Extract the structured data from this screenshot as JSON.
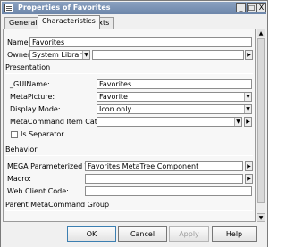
{
  "window": {
    "title": "Properties of Favorites",
    "minimize_glyph": "_",
    "maximize_glyph": "□",
    "close_glyph": "X"
  },
  "tabs": [
    {
      "label": "General",
      "active": false
    },
    {
      "label": "Characteristics",
      "active": true
    },
    {
      "label": "Texts",
      "active": false
    }
  ],
  "form": {
    "name_label": "Name:",
    "name_value": "Favorites",
    "owner_label": "Owner:",
    "owner_value": "System Library",
    "presentation_header": "Presentation",
    "guiname_label": "_GUIName:",
    "guiname_value": "Favorites",
    "metapicture_label": "MetaPicture:",
    "metapicture_value": "Favorite",
    "display_mode_label": "Display Mode:",
    "display_mode_value": "Icon only",
    "metacommand_category_label": "MetaCommand Item Category:",
    "metacommand_category_value": "",
    "is_separator_label": "Is Separator",
    "is_separator_checked": false,
    "behavior_header": "Behavior",
    "mega_tool_label": "MEGA Parameterized Tool:",
    "mega_tool_value": "Favorites MetaTree Component",
    "macro_label": "Macro:",
    "macro_value": "",
    "web_client_code_label": "Web Client Code:",
    "web_client_code_value": "",
    "parent_group_header": "Parent MetaCommand Group"
  },
  "glyphs": {
    "dropdown_arrow": "▼",
    "browse_arrow": "▶",
    "scroll_up": "▲",
    "scroll_down": "▼"
  },
  "buttons": {
    "ok": "OK",
    "cancel": "Cancel",
    "apply": "Apply",
    "help": "Help"
  }
}
